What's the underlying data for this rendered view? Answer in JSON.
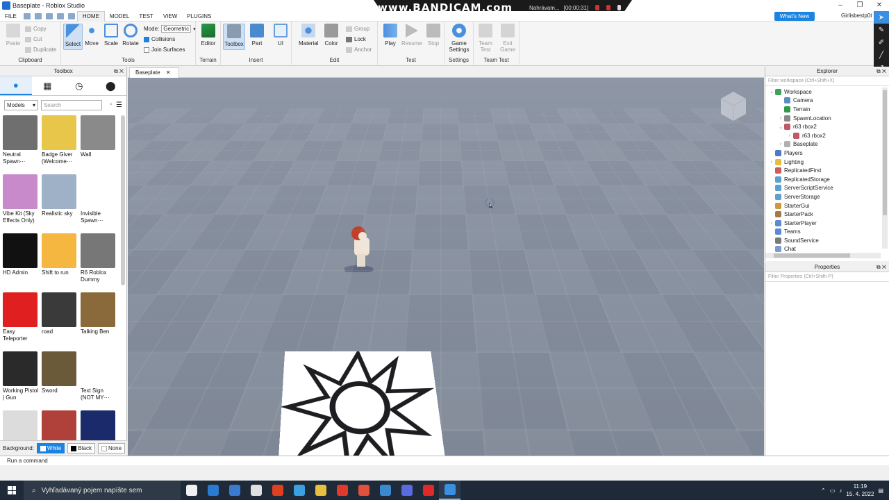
{
  "window": {
    "title": "Baseplate - Roblox Studio",
    "controls": [
      "–",
      "❐",
      "✕"
    ]
  },
  "recorder": {
    "brand": "www.BANDICAM.com",
    "status": "Nahrávam...",
    "time": "[00:00:31]"
  },
  "menu": {
    "file": "FILE",
    "tabs": [
      "HOME",
      "MODEL",
      "TEST",
      "VIEW",
      "PLUGINS"
    ],
    "active_tab": "HOME",
    "whats_new": "What's New",
    "username": "Girlisbestp0t"
  },
  "ribbon": {
    "clipboard": {
      "label": "Clipboard",
      "paste": "Paste",
      "copy": "Copy",
      "cut": "Cut",
      "duplicate": "Duplicate"
    },
    "tools": {
      "label": "Tools",
      "select": "Select",
      "move": "Move",
      "scale": "Scale",
      "rotate": "Rotate",
      "mode_label": "Mode:",
      "mode_value": "Geometric",
      "collisions": "Collisions",
      "join_surfaces": "Join Surfaces"
    },
    "terrain": {
      "label": "Terrain",
      "editor": "Editor"
    },
    "insert": {
      "label": "Insert",
      "toolbox": "Toolbox",
      "part": "Part",
      "ui": "UI"
    },
    "edit": {
      "label": "Edit",
      "material": "Material",
      "color": "Color",
      "group": "Group",
      "lock": "Lock",
      "anchor": "Anchor"
    },
    "test": {
      "label": "Test",
      "play": "Play",
      "resume": "Resume",
      "stop": "Stop"
    },
    "settings": {
      "label": "Settings",
      "game_settings": "Game Settings"
    },
    "team_test": {
      "label": "Team Test",
      "team_test_btn": "Team Test",
      "exit_game": "Exit Game"
    }
  },
  "toolbox": {
    "title": "Toolbox",
    "category": "Models",
    "search_placeholder": "Search",
    "items": [
      {
        "name": "Neutral Spawn···",
        "color": "#6f6f6f"
      },
      {
        "name": "Badge Giver (Welcome···",
        "color": "#e8c64a"
      },
      {
        "name": "Wall",
        "color": "#8a8a8a"
      },
      {
        "name": "Vibe Kit (Sky Effects Only)",
        "color": "#c88acb"
      },
      {
        "name": "Realistic sky",
        "color": "#9fb1c6"
      },
      {
        "name": "Invisible Spawn···",
        "color": "#ffffff"
      },
      {
        "name": "HD Admin",
        "color": "#111111"
      },
      {
        "name": "Shift to run",
        "color": "#f5b740"
      },
      {
        "name": "R6 Roblox Dummy",
        "color": "#777777"
      },
      {
        "name": "Easy Teleporter",
        "color": "#e02020"
      },
      {
        "name": "road",
        "color": "#3a3a3a"
      },
      {
        "name": "Talking Ben",
        "color": "#8a6a3a"
      },
      {
        "name": "Working Pistol | Gun",
        "color": "#2a2a2a"
      },
      {
        "name": "Sword",
        "color": "#6a5a3a"
      },
      {
        "name": "Text Sign (NOT MY···",
        "color": "#ffffff"
      },
      {
        "name": "",
        "color": "#dcdcdc"
      },
      {
        "name": "",
        "color": "#b0403a"
      },
      {
        "name": "",
        "color": "#1a2a6a"
      }
    ],
    "background_label": "Background:",
    "bg_options": [
      "White",
      "Black",
      "None"
    ]
  },
  "viewport": {
    "tab": "Baseplate"
  },
  "explorer": {
    "title": "Explorer",
    "filter": "Filter workspace (Ctrl+Shift+X)",
    "nodes": [
      {
        "label": "Workspace",
        "depth": 0,
        "arrow": "v",
        "color": "#3aa55a"
      },
      {
        "label": "Camera",
        "depth": 1,
        "arrow": "",
        "color": "#5a8fc0"
      },
      {
        "label": "Terrain",
        "depth": 1,
        "arrow": "",
        "color": "#2f9a4a"
      },
      {
        "label": "SpawnLocation",
        "depth": 1,
        "arrow": ">",
        "color": "#888888"
      },
      {
        "label": "r63 rbox2",
        "depth": 1,
        "arrow": "v",
        "color": "#c05a6a"
      },
      {
        "label": "r63 rbox2",
        "depth": 2,
        "arrow": ">",
        "color": "#c05a6a"
      },
      {
        "label": "Baseplate",
        "depth": 1,
        "arrow": ">",
        "color": "#b0b0b0"
      },
      {
        "label": "Players",
        "depth": 0,
        "arrow": "",
        "color": "#4a7ad0"
      },
      {
        "label": "Lighting",
        "depth": 0,
        "arrow": ">",
        "color": "#e0c040"
      },
      {
        "label": "ReplicatedFirst",
        "depth": 0,
        "arrow": "",
        "color": "#d05a5a"
      },
      {
        "label": "ReplicatedStorage",
        "depth": 0,
        "arrow": "",
        "color": "#5aa0d0"
      },
      {
        "label": "ServerScriptService",
        "depth": 0,
        "arrow": "",
        "color": "#5aa0d0"
      },
      {
        "label": "ServerStorage",
        "depth": 0,
        "arrow": "",
        "color": "#5aa0d0"
      },
      {
        "label": "StarterGui",
        "depth": 0,
        "arrow": "",
        "color": "#d09a3a"
      },
      {
        "label": "StarterPack",
        "depth": 0,
        "arrow": "",
        "color": "#a07a4a"
      },
      {
        "label": "StarterPlayer",
        "depth": 0,
        "arrow": ">",
        "color": "#5a8ad0"
      },
      {
        "label": "Teams",
        "depth": 0,
        "arrow": "",
        "color": "#5a8ad0"
      },
      {
        "label": "SoundService",
        "depth": 0,
        "arrow": "",
        "color": "#7a7a7a"
      },
      {
        "label": "Chat",
        "depth": 0,
        "arrow": "",
        "color": "#7a9ad0"
      }
    ]
  },
  "properties": {
    "title": "Properties",
    "filter": "Filter Properties (Ctrl+Shift+P)"
  },
  "command": {
    "placeholder": "Run a command"
  },
  "taskbar": {
    "search_placeholder": "Vyhľadávaný pojem napíšte sem",
    "apps": [
      "#f0f0f0",
      "#2a7ad0",
      "#3a7ad0",
      "#e0e0e0",
      "#e04020",
      "#3aa0e0",
      "#e8c040",
      "#e03a2a",
      "#e0503a",
      "#3a8ad0",
      "#5a6ae0",
      "#e02a2a",
      "#3a90e0"
    ],
    "time": "11:19",
    "date": "15. 4. 2022"
  }
}
